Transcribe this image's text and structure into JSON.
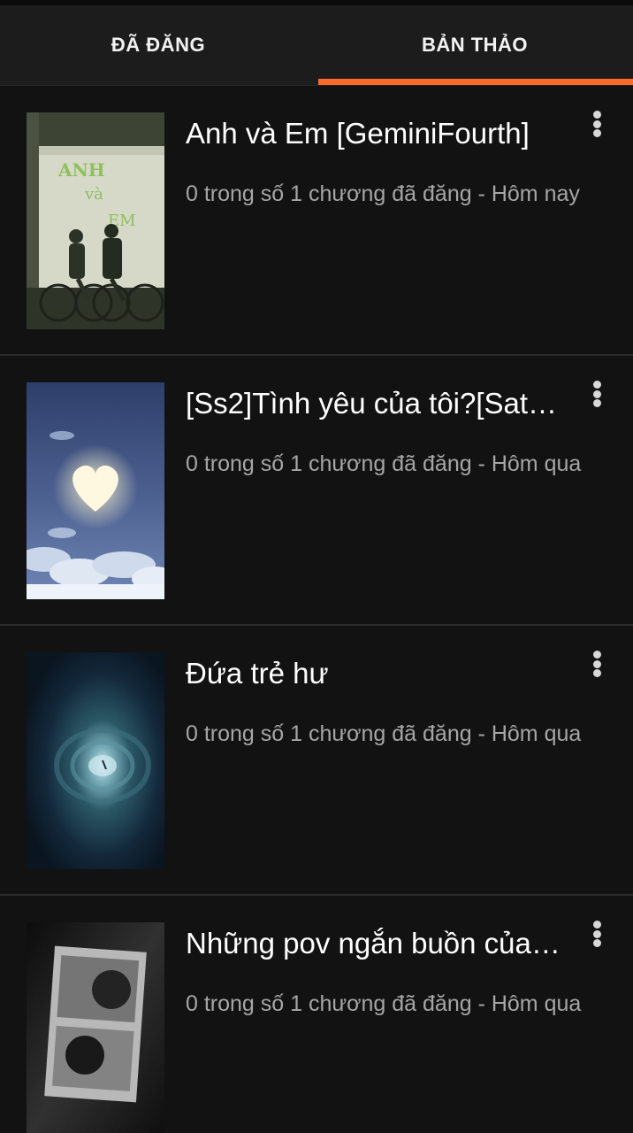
{
  "tabs": {
    "published": "ĐÃ ĐĂNG",
    "drafts": "BẢN THẢO"
  },
  "colors": {
    "accent": "#ff6a2b",
    "background": "#121212",
    "tabbar": "#1c1c1c"
  },
  "stories": [
    {
      "title": "Anh và Em [GeminiFourth]",
      "meta": "0 trong số 1 chương đã đăng - Hôm nay",
      "cover_icon": "cover-cyclists-image",
      "cover_text": "ANH và EM"
    },
    {
      "title": "[Ss2]Tình yêu của tôi?[Sat…",
      "meta": "0 trong số 1 chương đã đăng - Hôm qua",
      "cover_icon": "cover-heart-moon-image"
    },
    {
      "title": "Đứa trẻ hư",
      "meta": "0 trong số 1 chương đã đăng - Hôm qua",
      "cover_icon": "cover-cloud-vortex-image"
    },
    {
      "title": "Những pov ngắn buồn của …",
      "meta": "0 trong số 1 chương đã đăng - Hôm qua",
      "cover_icon": "cover-bw-photo-image"
    }
  ]
}
